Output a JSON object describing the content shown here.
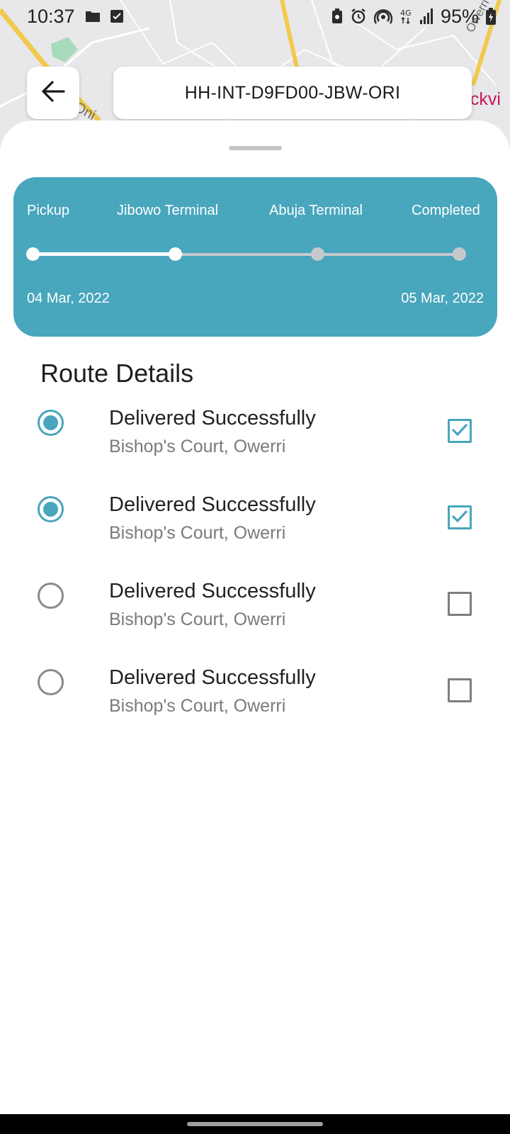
{
  "status_bar": {
    "time": "10:37",
    "battery": "95%",
    "network": "4G",
    "left_icons": [
      "folder-icon",
      "checkbox-notification-icon"
    ],
    "right_icons": [
      "battery-saver-icon",
      "alarm-icon",
      "hotspot-icon",
      "4g-icon",
      "signal-icon",
      "battery-charging-icon"
    ]
  },
  "map": {
    "labels": [
      "Oni",
      "Owerri-Okw",
      "ockvi"
    ]
  },
  "header": {
    "back_icon": "arrow-left-icon",
    "tracking_id": "HH-INT-D9FD00-JBW-ORI"
  },
  "progress": {
    "stages": [
      "Pickup",
      "Jibowo Terminal",
      "Abuja Terminal",
      "Completed"
    ],
    "completed_stage_index": 1,
    "start_date": "04 Mar, 2022",
    "end_date": "05 Mar, 2022"
  },
  "route_details": {
    "title": "Route Details",
    "items": [
      {
        "title": "Delivered Successfully",
        "location": "Bishop's Court, Owerri",
        "selected": true,
        "checked": true
      },
      {
        "title": "Delivered Successfully",
        "location": "Bishop's Court, Owerri",
        "selected": true,
        "checked": true
      },
      {
        "title": "Delivered Successfully",
        "location": "Bishop's Court, Owerri",
        "selected": false,
        "checked": false
      },
      {
        "title": "Delivered Successfully",
        "location": "Bishop's Court, Owerri",
        "selected": false,
        "checked": false
      }
    ]
  },
  "colors": {
    "accent": "#48a6bd",
    "map_background": "#e8e8ea",
    "map_road": "#f2c94c",
    "map_park": "#a8dbbc",
    "inactive_track": "#c6c9cc",
    "subtext": "#7a7a7a"
  }
}
